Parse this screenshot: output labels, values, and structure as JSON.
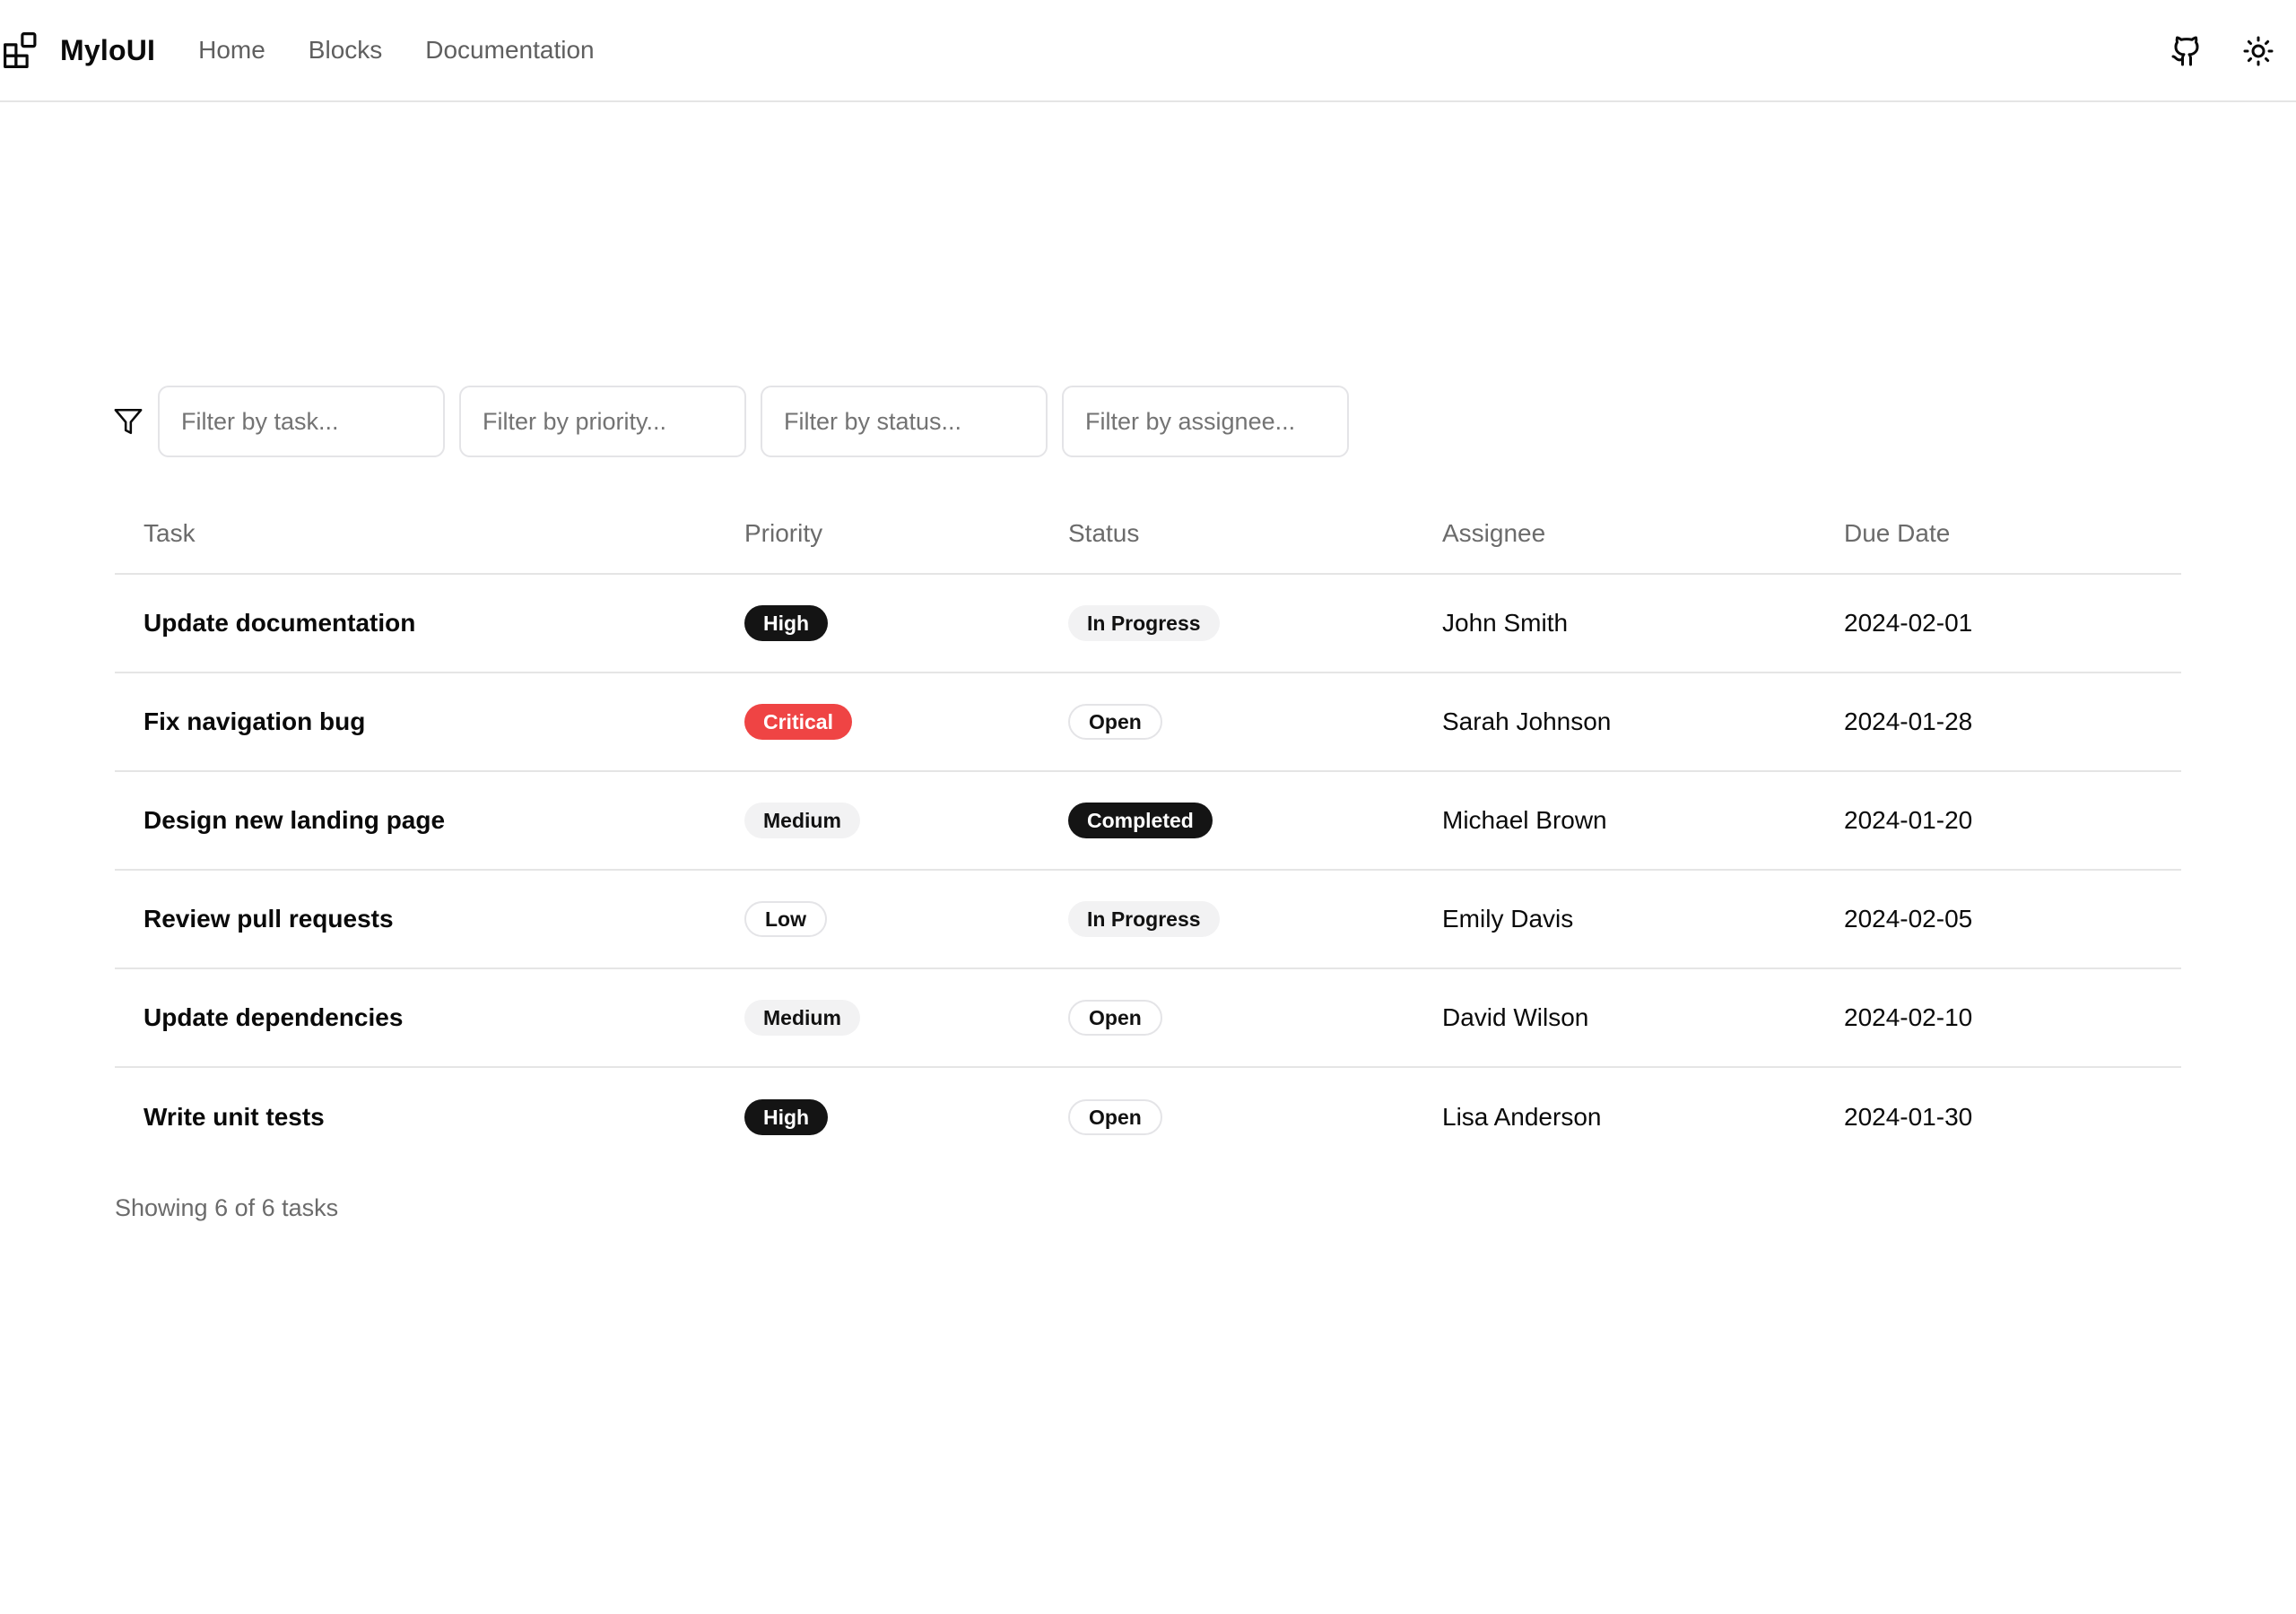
{
  "header": {
    "brand": "MyloUI",
    "nav": [
      {
        "label": "Home"
      },
      {
        "label": "Blocks"
      },
      {
        "label": "Documentation"
      }
    ],
    "icons": {
      "github": "github-icon",
      "theme": "sun-icon"
    }
  },
  "filters": {
    "icon": "filter-icon",
    "task": {
      "value": "",
      "placeholder": "Filter by task..."
    },
    "priority": {
      "value": "",
      "placeholder": "Filter by priority..."
    },
    "status": {
      "value": "",
      "placeholder": "Filter by status..."
    },
    "assignee": {
      "value": "",
      "placeholder": "Filter by assignee..."
    }
  },
  "table": {
    "columns": [
      "Task",
      "Priority",
      "Status",
      "Assignee",
      "Due Date"
    ],
    "rows": [
      {
        "task": "Update documentation",
        "priority": "High",
        "status": "In Progress",
        "assignee": "John Smith",
        "due": "2024-02-01"
      },
      {
        "task": "Fix navigation bug",
        "priority": "Critical",
        "status": "Open",
        "assignee": "Sarah Johnson",
        "due": "2024-01-28"
      },
      {
        "task": "Design new landing page",
        "priority": "Medium",
        "status": "Completed",
        "assignee": "Michael Brown",
        "due": "2024-01-20"
      },
      {
        "task": "Review pull requests",
        "priority": "Low",
        "status": "In Progress",
        "assignee": "Emily Davis",
        "due": "2024-02-05"
      },
      {
        "task": "Update dependencies",
        "priority": "Medium",
        "status": "Open",
        "assignee": "David Wilson",
        "due": "2024-02-10"
      },
      {
        "task": "Write unit tests",
        "priority": "High",
        "status": "Open",
        "assignee": "Lisa Anderson",
        "due": "2024-01-30"
      }
    ]
  },
  "footer": {
    "count_text": "Showing 6 of 6 tasks"
  },
  "colors": {
    "critical": "#ef4444",
    "dark_badge": "#141414",
    "soft_badge": "#f2f2f3",
    "border": "#e5e5e5"
  }
}
